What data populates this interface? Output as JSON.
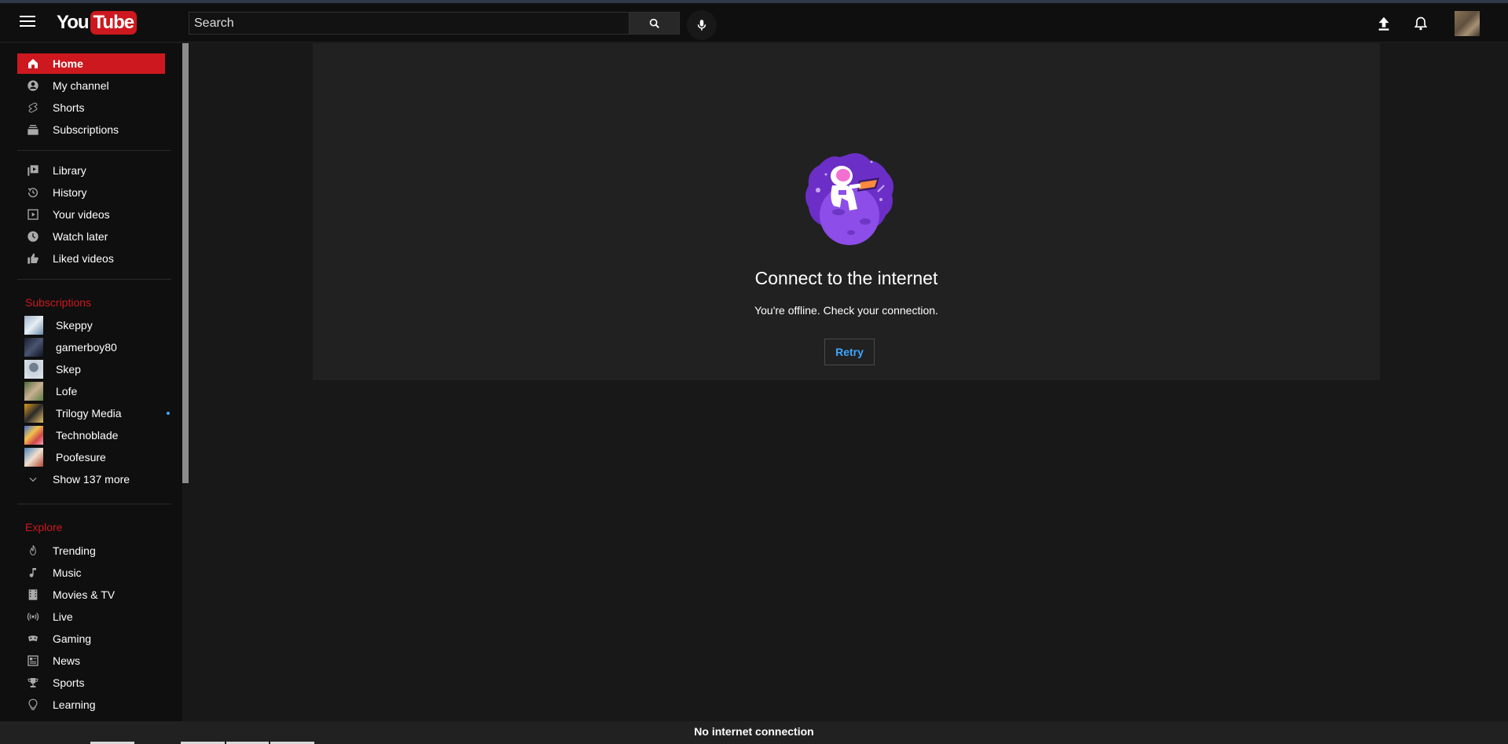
{
  "header": {
    "logo_you": "You",
    "logo_tube": "Tube",
    "search_placeholder": "Search"
  },
  "sidebar": {
    "main_items": [
      {
        "label": "Home",
        "icon": "home-icon",
        "active": true
      },
      {
        "label": "My channel",
        "icon": "account-icon"
      },
      {
        "label": "Shorts",
        "icon": "shorts-icon"
      },
      {
        "label": "Subscriptions",
        "icon": "subscriptions-icon"
      }
    ],
    "library_items": [
      {
        "label": "Library",
        "icon": "library-icon"
      },
      {
        "label": "History",
        "icon": "history-icon"
      },
      {
        "label": "Your videos",
        "icon": "your-videos-icon"
      },
      {
        "label": "Watch later",
        "icon": "watch-later-icon"
      },
      {
        "label": "Liked videos",
        "icon": "liked-icon"
      }
    ],
    "subscriptions_title": "Subscriptions",
    "subscriptions": [
      {
        "label": "Skeppy"
      },
      {
        "label": "gamerboy80"
      },
      {
        "label": "Skep"
      },
      {
        "label": "Lofe"
      },
      {
        "label": "Trilogy Media",
        "new": true
      },
      {
        "label": "Technoblade"
      },
      {
        "label": "Poofesure"
      }
    ],
    "show_more": "Show 137 more",
    "explore_title": "Explore",
    "explore_items": [
      {
        "label": "Trending",
        "icon": "trending-icon"
      },
      {
        "label": "Music",
        "icon": "music-icon"
      },
      {
        "label": "Movies & TV",
        "icon": "movies-icon"
      },
      {
        "label": "Live",
        "icon": "live-icon"
      },
      {
        "label": "Gaming",
        "icon": "gaming-icon"
      },
      {
        "label": "News",
        "icon": "news-icon"
      },
      {
        "label": "Sports",
        "icon": "sports-icon"
      },
      {
        "label": "Learning",
        "icon": "learning-icon"
      }
    ]
  },
  "offline": {
    "title": "Connect to the internet",
    "message": "You're offline. Check your connection.",
    "retry_label": "Retry"
  },
  "status_bar": "No internet connection",
  "colors": {
    "accent": "#cc181e",
    "link": "#3ea6ff",
    "background": "#181818",
    "sidebar": "#0f0f0f"
  }
}
